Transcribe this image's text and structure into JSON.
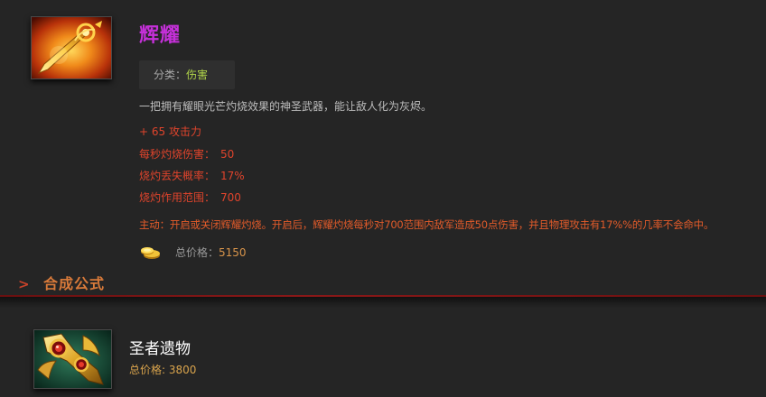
{
  "item": {
    "name": "辉耀",
    "icon": "radiance-sword-icon",
    "category_label": "分类：",
    "category_value": "伤害",
    "description": "一把拥有耀眼光芒灼烧效果的神圣武器，能让敌人化为灰烬。",
    "stats": [
      {
        "label": "+ 65 攻击力",
        "value": ""
      },
      {
        "label": "每秒灼烧伤害：",
        "value": "50"
      },
      {
        "label": "烧灼丢失概率：",
        "value": "17%"
      },
      {
        "label": "烧灼作用范围：",
        "value": "700"
      }
    ],
    "active": "主动：开启或关闭辉耀灼烧。开启后，辉耀灼烧每秒对700范围内敌军造成50点伤害，并且物理攻击有17%%的几率不会命中。",
    "cost_icon": "gold-coins-icon",
    "cost_label": "总价格：",
    "cost_value": "5150"
  },
  "section": {
    "arrow": ">",
    "title": "合成公式"
  },
  "recipe": {
    "name": "圣者遗物",
    "icon": "sacred-relic-icon",
    "cost_label": "总价格: ",
    "cost_value": "3800"
  },
  "colors": {
    "background": "#252525",
    "item_title": "#c530d9",
    "stat_red": "#e0442c",
    "active_orange": "#e25b2a",
    "category_green": "#b0d44a",
    "section_title": "#d87a3a",
    "divider": "#8a1818",
    "gold": "#d8a34c"
  }
}
